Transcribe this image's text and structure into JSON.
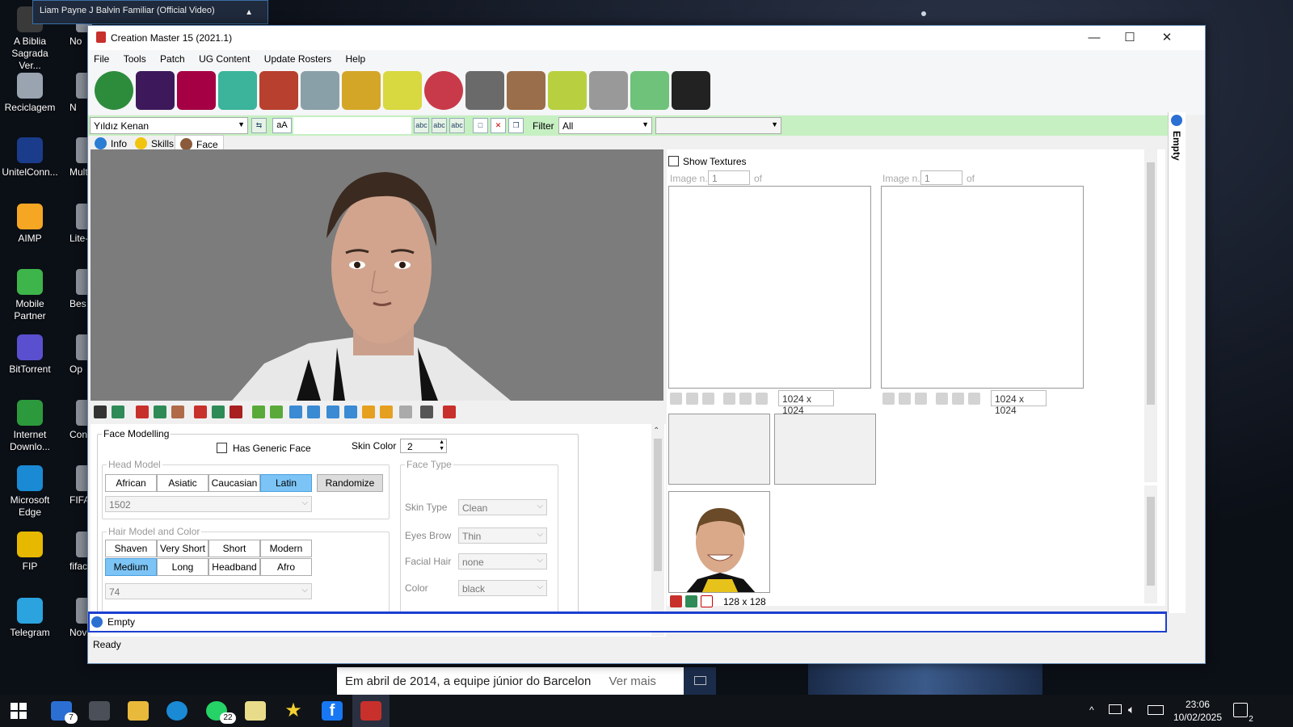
{
  "desktop": {
    "media_popup": "Liam Payne  J Balvin  Familiar (Official Video)",
    "icons": [
      {
        "label": "A Biblia Sagrada Ver...",
        "color": "#3a3a3a"
      },
      {
        "label": "Reciclagem",
        "color": "#9aa4b0"
      },
      {
        "label": "UnitelConn...",
        "color": "#1a3c8a"
      },
      {
        "label": "AIMP",
        "color": "#f5a623"
      },
      {
        "label": "Mobile Partner",
        "color": "#3db54a"
      },
      {
        "label": "BitTorrent",
        "color": "#5a4fcf"
      },
      {
        "label": "Internet Downlo...",
        "color": "#2c9a3c"
      },
      {
        "label": "Microsoft Edge",
        "color": "#1a8ad4"
      },
      {
        "label": "FIP",
        "color": "#e6b800"
      },
      {
        "label": "Telegram",
        "color": "#2aa3df"
      }
    ],
    "icons_col2": [
      "No",
      "N",
      "Mult",
      "Lite-l",
      "Bes",
      "Op",
      "Con",
      "FIFAC - A",
      "fifac At",
      "Nov"
    ],
    "fb_strip_text": "Em abril de 2014, a equipe júnior do Barcelon",
    "fb_strip_more": "Ver mais"
  },
  "window": {
    "title": "Creation Master 15 (2021.1)",
    "minimize_glyph": "—",
    "maximize_glyph": "☐",
    "close_glyph": "✕",
    "menu": [
      "File",
      "Tools",
      "Patch",
      "UG Content",
      "Update Rosters",
      "Help"
    ],
    "toolbar_icons": [
      {
        "name": "globe",
        "color": "#2d8c3c"
      },
      {
        "name": "premier-league-lion",
        "color": "#3d195b"
      },
      {
        "name": "fcb-crest",
        "color": "#a50044"
      },
      {
        "name": "jersey",
        "color": "#3bb49b"
      },
      {
        "name": "player-portrait",
        "color": "#b8402f"
      },
      {
        "name": "stadium",
        "color": "#8aa0a8"
      },
      {
        "name": "trophy",
        "color": "#d4a628"
      },
      {
        "name": "referee",
        "color": "#d8d840"
      },
      {
        "name": "ball",
        "color": "#c83a4a"
      },
      {
        "name": "boot",
        "color": "#6a6a6a"
      },
      {
        "name": "manager",
        "color": "#9a6e4a"
      },
      {
        "name": "tactics-board",
        "color": "#b8d040"
      },
      {
        "name": "newspaper",
        "color": "#999999"
      },
      {
        "name": "gloves",
        "color": "#6fc27a"
      },
      {
        "name": "speaker",
        "color": "#222222"
      }
    ],
    "player_select": "Yıldız Kenan",
    "aa_button": "aA",
    "filter_label": "Filter",
    "filter_value": "All",
    "filter_value2": "",
    "tabs": [
      {
        "label": "Info",
        "color": "#2b7cd3"
      },
      {
        "label": "Skills",
        "color": "#f1c40f"
      },
      {
        "label": "Face",
        "color": "#8a5a3a"
      }
    ],
    "face_modelling": {
      "title": "Face Modelling",
      "has_generic_face": "Has Generic Face",
      "skin_color_label": "Skin Color",
      "skin_color_value": "2",
      "head_model_title": "Head Model",
      "head_models": [
        "African",
        "Asiatic",
        "Caucasian",
        "Latin"
      ],
      "head_model_selected": "Latin",
      "randomize": "Randomize",
      "head_id": "1502",
      "hair_title": "Hair Model and Color",
      "hair_row1": [
        "Shaven",
        "Very Short",
        "Short",
        "Modern"
      ],
      "hair_row2": [
        "Medium",
        "Long",
        "Headband",
        "Afro"
      ],
      "hair_selected": "Medium",
      "hair_id": "74",
      "face_type_title": "Face Type",
      "skin_type_label": "Skin Type",
      "skin_type_value": "Clean",
      "eyes_brow_label": "Eyes Brow",
      "eyes_brow_value": "Thin",
      "facial_hair_label": "Facial Hair",
      "facial_hair_value": "none",
      "color_label": "Color",
      "color_value": "black"
    },
    "textures": {
      "show_textures": "Show Textures",
      "image_n_label": "Image n.",
      "image_n_value": "1",
      "of_label": "of",
      "size_left": "1024 x 1024",
      "size_right": "1024 x 1024",
      "photo_size": "128 x 128"
    },
    "side_label": "Empty",
    "bottom_label": "Empty",
    "status": "Ready"
  },
  "taskbar": {
    "mail_badge": "7",
    "whatsapp_badge": "22",
    "time": "23:06",
    "date": "10/02/2025",
    "notif_badge": "2"
  }
}
